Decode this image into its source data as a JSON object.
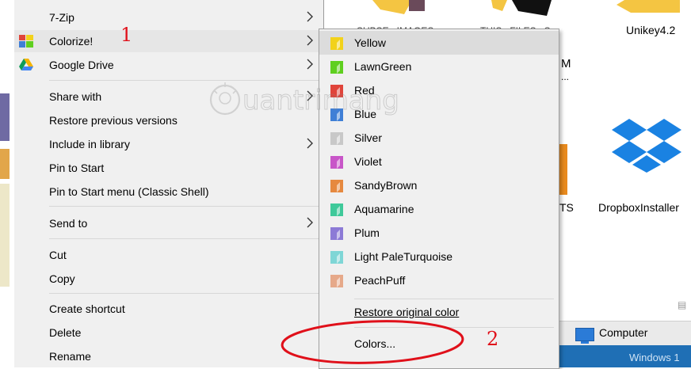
{
  "desktop": {
    "top_labels": [
      "SUBSE...IMAGES...",
      "THIS...FILES...S",
      "Unikey4.2"
    ],
    "partial_labels": [
      "M",
      "..."
    ],
    "ts_label": "TS",
    "dropbox_label": "DropboxInstaller",
    "taskbar_computer": "Computer",
    "windows_banner": "Windows 1"
  },
  "main_menu": {
    "items": [
      {
        "label": "7-Zip",
        "submenu": true
      },
      {
        "label": "Colorize!",
        "submenu": true,
        "icon": "colorize-icon"
      },
      {
        "label": "Google Drive",
        "submenu": true,
        "icon": "google-drive-icon"
      },
      {
        "label": "Share with",
        "submenu": true
      },
      {
        "label": "Restore previous versions",
        "submenu": false
      },
      {
        "label": "Include in library",
        "submenu": true
      },
      {
        "label": "Pin to Start",
        "submenu": false
      },
      {
        "label": "Pin to Start menu (Classic Shell)",
        "submenu": false
      },
      {
        "label": "Send to",
        "submenu": true
      },
      {
        "label": "Cut",
        "submenu": false
      },
      {
        "label": "Copy",
        "submenu": false
      },
      {
        "label": "Create shortcut",
        "submenu": false
      },
      {
        "label": "Delete",
        "submenu": false
      },
      {
        "label": "Rename",
        "submenu": false
      }
    ]
  },
  "colorize_menu": {
    "colors": [
      {
        "label": "Yellow",
        "color": "#f2d21b"
      },
      {
        "label": "LawnGreen",
        "color": "#5fcf1f"
      },
      {
        "label": "Red",
        "color": "#e0443a"
      },
      {
        "label": "Blue",
        "color": "#3f7fd6"
      },
      {
        "label": "Silver",
        "color": "#c8c8c8"
      },
      {
        "label": "Violet",
        "color": "#c856c8"
      },
      {
        "label": "SandyBrown",
        "color": "#e6893f"
      },
      {
        "label": "Aquamarine",
        "color": "#3fc99a"
      },
      {
        "label": "Plum",
        "color": "#8c7ad6"
      },
      {
        "label": "Light PaleTurquoise",
        "color": "#7fd6d6"
      },
      {
        "label": "PeachPuff",
        "color": "#e6a98a"
      }
    ],
    "restore_label": "Restore original color",
    "colors_more_label": "Colors..."
  },
  "annotations": {
    "step1": "1",
    "step2": "2",
    "accent": "#e0101a"
  },
  "watermark": "Quantrimang"
}
